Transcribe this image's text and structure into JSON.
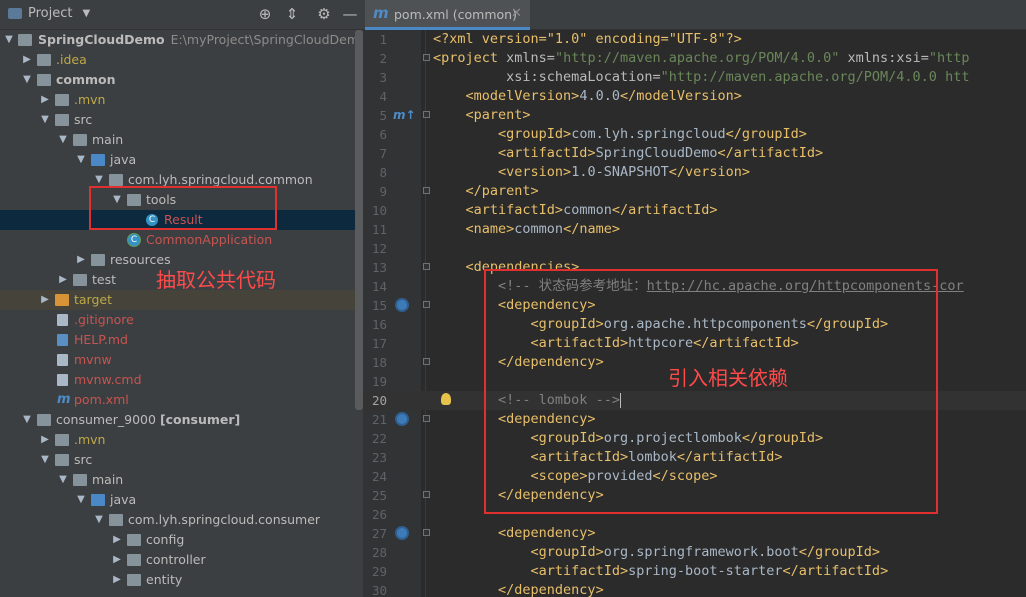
{
  "project_panel": {
    "title": "Project",
    "tree": [
      {
        "label": "SpringCloudDemo",
        "path": "E:\\myProject\\SpringCloudDemo"
      },
      {
        "label": ".idea"
      },
      {
        "label": "common"
      },
      {
        "label": ".mvn"
      },
      {
        "label": "src"
      },
      {
        "label": "main"
      },
      {
        "label": "java"
      },
      {
        "label": "com.lyh.springcloud.common"
      },
      {
        "label": "tools"
      },
      {
        "label": "Result"
      },
      {
        "label": "CommonApplication"
      },
      {
        "label": "resources"
      },
      {
        "label": "test"
      },
      {
        "label": "target"
      },
      {
        "label": ".gitignore"
      },
      {
        "label": "HELP.md"
      },
      {
        "label": "mvnw"
      },
      {
        "label": "mvnw.cmd"
      },
      {
        "label": "pom.xml"
      },
      {
        "label": "consumer_9000",
        "module": "[consumer]"
      },
      {
        "label": ".mvn"
      },
      {
        "label": "src"
      },
      {
        "label": "main"
      },
      {
        "label": "java"
      },
      {
        "label": "com.lyh.springcloud.consumer"
      },
      {
        "label": "config"
      },
      {
        "label": "controller"
      },
      {
        "label": "entity"
      }
    ],
    "annotation": "抽取公共代码"
  },
  "editor": {
    "tab_label": "pom.xml (common)",
    "annotation": "引入相关依赖",
    "lines": [
      {
        "n": "1"
      },
      {
        "n": "2"
      },
      {
        "n": "3"
      },
      {
        "n": "4"
      },
      {
        "n": "5"
      },
      {
        "n": "6"
      },
      {
        "n": "7"
      },
      {
        "n": "8"
      },
      {
        "n": "9"
      },
      {
        "n": "10"
      },
      {
        "n": "11"
      },
      {
        "n": "12"
      },
      {
        "n": "13"
      },
      {
        "n": "14"
      },
      {
        "n": "15"
      },
      {
        "n": "16"
      },
      {
        "n": "17"
      },
      {
        "n": "18"
      },
      {
        "n": "19"
      },
      {
        "n": "20"
      },
      {
        "n": "21"
      },
      {
        "n": "22"
      },
      {
        "n": "23"
      },
      {
        "n": "24"
      },
      {
        "n": "25"
      },
      {
        "n": "26"
      },
      {
        "n": "27"
      },
      {
        "n": "28"
      },
      {
        "n": "29"
      },
      {
        "n": "30"
      }
    ],
    "code": {
      "l1_decl": "<?xml version=\"1.0\" encoding=\"UTF-8\"?>",
      "l2_open": "<project",
      "l2_attr1": " xmlns=",
      "l2_val1": "\"http://maven.apache.org/POM/4.0.0\"",
      "l2_attr2": " xmlns:xsi=",
      "l2_val2": "\"http",
      "l3_attr": "xsi:schemaLocation=",
      "l3_val": "\"http://maven.apache.org/POM/4.0.0 htt",
      "l4_text": "4.0.0",
      "l6_text": "com.lyh.springcloud",
      "l7_text": "SpringCloudDemo",
      "l8_text": "1.0-SNAPSHOT",
      "l10_text": "common",
      "l11_text": "common",
      "l14_comment": "<!-- 状态码参考地址：",
      "l14_link": "http://hc.apache.org/httpcomponents-cor",
      "l16_text": "org.apache.httpcomponents",
      "l17_text": "httpcore",
      "l20_comment": "<!-- lombok -->",
      "l22_text": "org.projectlombok",
      "l23_text": "lombok",
      "l24_text": "provided",
      "l28_text": "org.springframework.boot",
      "l29_text": "spring-boot-starter"
    }
  },
  "colors": {
    "annotation_red": "#e0302f",
    "xml_tag": "#e8bf6a",
    "xml_string": "#6a8759",
    "comment": "#808080"
  }
}
